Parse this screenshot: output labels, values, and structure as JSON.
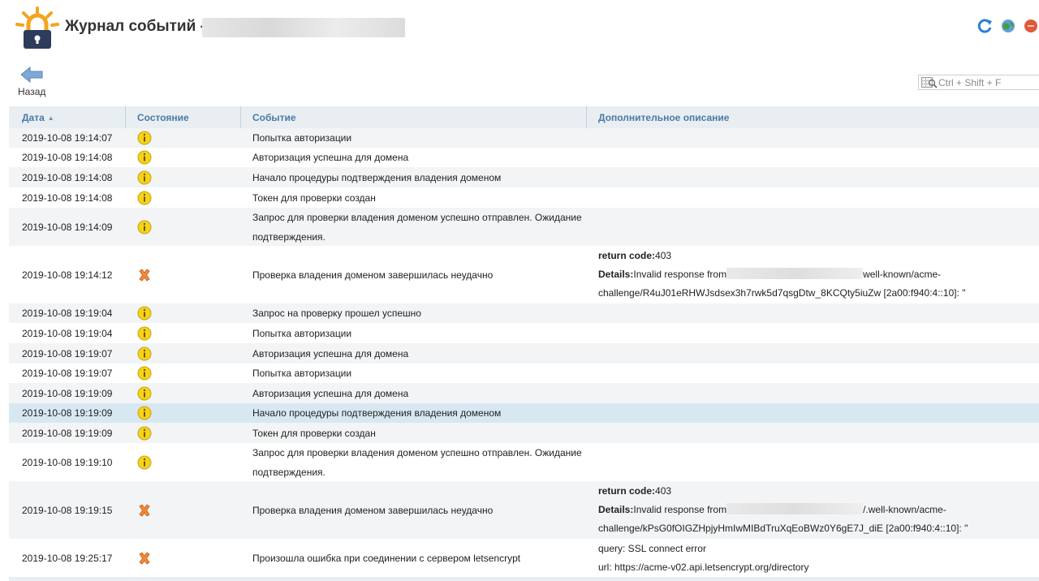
{
  "header": {
    "title": "Журнал событий -",
    "top_icons": [
      "refresh-icon",
      "globe-icon",
      "close-icon"
    ]
  },
  "toolbar": {
    "back_label": "Назад",
    "search_placeholder": "Ctrl + Shift + F"
  },
  "columns": {
    "date": "Дата",
    "state": "Состояние",
    "event": "Событие",
    "description": "Дополнительное описание"
  },
  "rows": [
    {
      "date": "2019-10-08 19:14:07",
      "status": "info",
      "event": "Попытка авторизации"
    },
    {
      "date": "2019-10-08 19:14:08",
      "status": "info",
      "event": "Авторизация успешна для домена"
    },
    {
      "date": "2019-10-08 19:14:08",
      "status": "info",
      "event": "Начало процедуры подтверждения владения доменом"
    },
    {
      "date": "2019-10-08 19:14:08",
      "status": "info",
      "event": "Токен для проверки создан"
    },
    {
      "date": "2019-10-08 19:14:09",
      "status": "info",
      "event": "Запрос для проверки владения доменом успешно отправлен. Ожидание подтверждения."
    },
    {
      "date": "2019-10-08 19:14:12",
      "status": "error",
      "event": "Проверка владения доменом завершилась неудачно",
      "desc": {
        "return_code_label": "return code:",
        "return_code": "403",
        "details_label": "Details:",
        "details_prefix": "Invalid response from",
        "details_suffix": "well-known/acme-",
        "details_line2": "challenge/R4uJ01eRHWJsdsex3h7rwk5d7qsgDtw_8KCQty5iuZw [2a00:f940:4::10]: \""
      }
    },
    {
      "date": "2019-10-08 19:19:04",
      "status": "info",
      "event": "Запрос на проверку прошел успешно"
    },
    {
      "date": "2019-10-08 19:19:04",
      "status": "info",
      "event": "Попытка авторизации"
    },
    {
      "date": "2019-10-08 19:19:07",
      "status": "info",
      "event": "Авторизация успешна для домена"
    },
    {
      "date": "2019-10-08 19:19:07",
      "status": "info",
      "event": "Попытка авторизации"
    },
    {
      "date": "2019-10-08 19:19:09",
      "status": "info",
      "event": "Авторизация успешна для домена"
    },
    {
      "date": "2019-10-08 19:19:09",
      "status": "info",
      "event": "Начало процедуры подтверждения владения доменом",
      "selected": true
    },
    {
      "date": "2019-10-08 19:19:09",
      "status": "info",
      "event": "Токен для проверки создан"
    },
    {
      "date": "2019-10-08 19:19:10",
      "status": "info",
      "event": "Запрос для проверки владения доменом успешно отправлен. Ожидание подтверждения."
    },
    {
      "date": "2019-10-08 19:19:15",
      "status": "error",
      "event": "Проверка владения доменом завершилась неудачно",
      "desc": {
        "return_code_label": "return code:",
        "return_code": "403",
        "details_label": "Details:",
        "details_prefix": "Invalid response from",
        "details_suffix": "/.well-known/acme-",
        "details_line2": "challenge/kPsG0fOIGZHpjyHmIwMIBdTruXqEoBWz0Y6gE7J_diE [2a00:f940:4::10]: \""
      }
    },
    {
      "date": "2019-10-08 19:25:17",
      "status": "error",
      "event": "Произошла ошибка при соединении с сервером letsencrypt",
      "desc_lines": [
        "query: SSL connect error",
        "url: https://acme-v02.api.letsencrypt.org/directory"
      ]
    }
  ]
}
